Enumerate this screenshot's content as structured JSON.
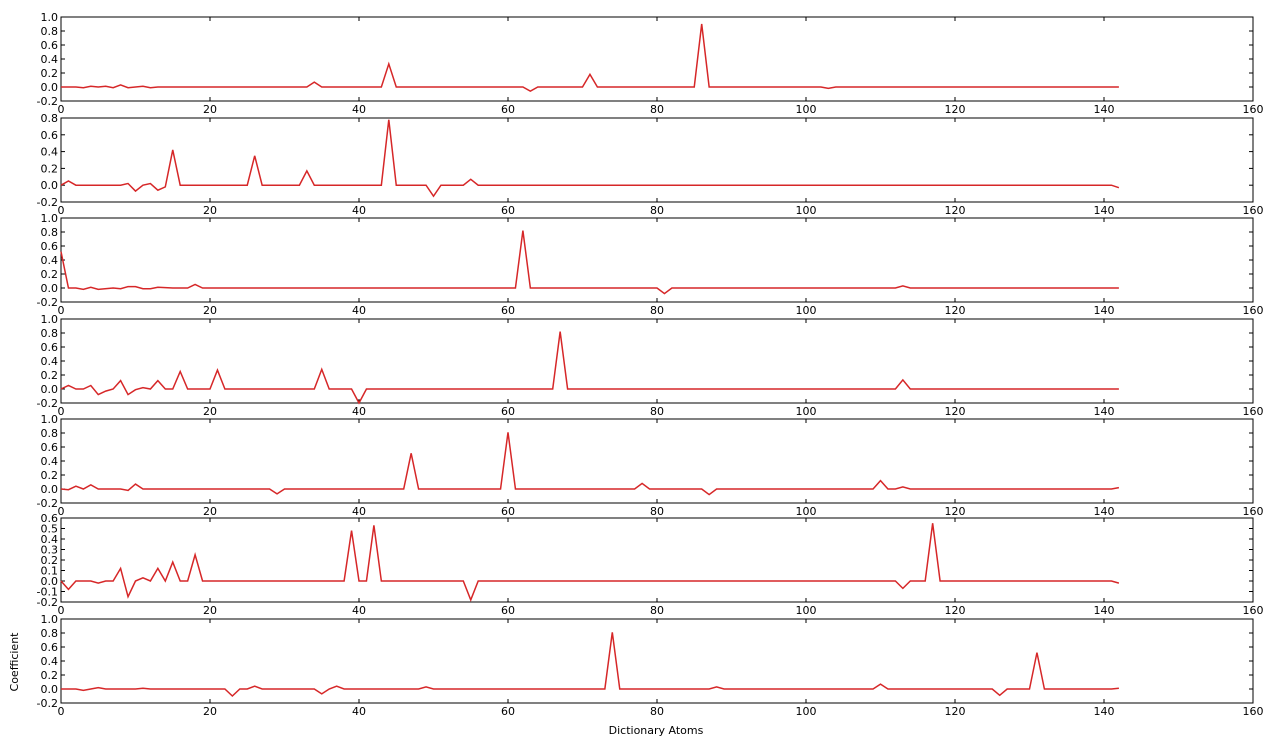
{
  "chart_data": {
    "type": "line",
    "xlabel": "Dictionary Atoms",
    "ylabel": "Coefficient",
    "line_color": "#d62728",
    "grid": false,
    "subplots": [
      {
        "xlim": [
          0,
          160
        ],
        "ylim": [
          -0.2,
          1.0
        ],
        "xticks": [
          0,
          20,
          40,
          60,
          80,
          100,
          120,
          140,
          160
        ],
        "yticks": [
          "1.0",
          "0.8",
          "0.6",
          "0.4",
          "0.2",
          "0.0",
          "-0.2"
        ],
        "ytick_values": [
          1.0,
          0.8,
          0.6,
          0.4,
          0.2,
          0.0,
          -0.2
        ],
        "points": [
          [
            0,
            0
          ],
          [
            2,
            0
          ],
          [
            3,
            -0.01
          ],
          [
            4,
            0.01
          ],
          [
            5,
            0
          ],
          [
            6,
            0.01
          ],
          [
            7,
            -0.01
          ],
          [
            8,
            0.03
          ],
          [
            9,
            -0.01
          ],
          [
            11,
            0.01
          ],
          [
            12,
            -0.01
          ],
          [
            13,
            0
          ],
          [
            33,
            0
          ],
          [
            34,
            0.07
          ],
          [
            35,
            0
          ],
          [
            43,
            0
          ],
          [
            44,
            0.33
          ],
          [
            45,
            0
          ],
          [
            62,
            0
          ],
          [
            63,
            -0.06
          ],
          [
            64,
            0
          ],
          [
            70,
            0
          ],
          [
            71,
            0.18
          ],
          [
            72,
            0
          ],
          [
            85,
            0
          ],
          [
            86,
            0.9
          ],
          [
            87,
            0
          ],
          [
            102,
            0
          ],
          [
            103,
            -0.02
          ],
          [
            104,
            0
          ],
          [
            142,
            0
          ]
        ]
      },
      {
        "xlim": [
          0,
          160
        ],
        "ylim": [
          -0.2,
          0.8
        ],
        "xticks": [
          0,
          20,
          40,
          60,
          80,
          100,
          120,
          140,
          160
        ],
        "yticks": [
          "0.8",
          "0.6",
          "0.4",
          "0.2",
          "0.0",
          "-0.2"
        ],
        "ytick_values": [
          0.8,
          0.6,
          0.4,
          0.2,
          0.0,
          -0.2
        ],
        "points": [
          [
            0,
            0
          ],
          [
            1,
            0.05
          ],
          [
            2,
            0
          ],
          [
            8,
            0
          ],
          [
            9,
            0.02
          ],
          [
            10,
            -0.07
          ],
          [
            11,
            0
          ],
          [
            12,
            0.02
          ],
          [
            13,
            -0.06
          ],
          [
            14,
            -0.02
          ],
          [
            15,
            0.42
          ],
          [
            16,
            0
          ],
          [
            25,
            0
          ],
          [
            26,
            0.35
          ],
          [
            27,
            0
          ],
          [
            32,
            0
          ],
          [
            33,
            0.17
          ],
          [
            34,
            0
          ],
          [
            43,
            0
          ],
          [
            44,
            0.78
          ],
          [
            45,
            0
          ],
          [
            49,
            0
          ],
          [
            50,
            -0.13
          ],
          [
            51,
            0
          ],
          [
            54,
            0
          ],
          [
            55,
            0.07
          ],
          [
            56,
            0
          ],
          [
            141,
            0
          ],
          [
            142,
            -0.03
          ]
        ]
      },
      {
        "xlim": [
          0,
          160
        ],
        "ylim": [
          -0.2,
          1.0
        ],
        "xticks": [
          0,
          20,
          40,
          60,
          80,
          100,
          120,
          140,
          160
        ],
        "yticks": [
          "1.0",
          "0.8",
          "0.6",
          "0.4",
          "0.2",
          "0.0",
          "-0.2"
        ],
        "ytick_values": [
          1.0,
          0.8,
          0.6,
          0.4,
          0.2,
          0.0,
          -0.2
        ],
        "points": [
          [
            0,
            0.52
          ],
          [
            1,
            0
          ],
          [
            2,
            0
          ],
          [
            3,
            -0.02
          ],
          [
            4,
            0.01
          ],
          [
            5,
            -0.02
          ],
          [
            7,
            0
          ],
          [
            8,
            -0.01
          ],
          [
            9,
            0.02
          ],
          [
            10,
            0.02
          ],
          [
            11,
            -0.01
          ],
          [
            12,
            -0.01
          ],
          [
            13,
            0.01
          ],
          [
            15,
            0
          ],
          [
            17,
            0
          ],
          [
            18,
            0.05
          ],
          [
            19,
            0
          ],
          [
            61,
            0
          ],
          [
            62,
            0.82
          ],
          [
            63,
            0
          ],
          [
            80,
            0
          ],
          [
            81,
            -0.08
          ],
          [
            82,
            0
          ],
          [
            112,
            0
          ],
          [
            113,
            0.03
          ],
          [
            114,
            0
          ],
          [
            142,
            0
          ]
        ]
      },
      {
        "xlim": [
          0,
          160
        ],
        "ylim": [
          -0.2,
          1.0
        ],
        "xticks": [
          0,
          20,
          40,
          60,
          80,
          100,
          120,
          140,
          160
        ],
        "yticks": [
          "1.0",
          "0.8",
          "0.6",
          "0.4",
          "0.2",
          "0.0",
          "-0.2"
        ],
        "ytick_values": [
          1.0,
          0.8,
          0.6,
          0.4,
          0.2,
          0.0,
          -0.2
        ],
        "points": [
          [
            0,
            0
          ],
          [
            1,
            0.05
          ],
          [
            2,
            0
          ],
          [
            3,
            0
          ],
          [
            4,
            0.05
          ],
          [
            5,
            -0.08
          ],
          [
            6,
            -0.03
          ],
          [
            7,
            0
          ],
          [
            8,
            0.12
          ],
          [
            9,
            -0.08
          ],
          [
            10,
            -0.01
          ],
          [
            11,
            0.02
          ],
          [
            12,
            0
          ],
          [
            13,
            0.12
          ],
          [
            14,
            0
          ],
          [
            15,
            0
          ],
          [
            16,
            0.25
          ],
          [
            17,
            0
          ],
          [
            20,
            0
          ],
          [
            21,
            0.27
          ],
          [
            22,
            0
          ],
          [
            34,
            0
          ],
          [
            35,
            0.28
          ],
          [
            36,
            0
          ],
          [
            39,
            0
          ],
          [
            40,
            -0.2
          ],
          [
            41,
            0
          ],
          [
            66,
            0
          ],
          [
            67,
            0.82
          ],
          [
            68,
            0
          ],
          [
            112,
            0
          ],
          [
            113,
            0.13
          ],
          [
            114,
            0
          ],
          [
            142,
            0
          ]
        ]
      },
      {
        "xlim": [
          0,
          160
        ],
        "ylim": [
          -0.2,
          1.0
        ],
        "xticks": [
          0,
          20,
          40,
          60,
          80,
          100,
          120,
          140,
          160
        ],
        "yticks": [
          "1.0",
          "0.8",
          "0.6",
          "0.4",
          "0.2",
          "0.0",
          "-0.2"
        ],
        "ytick_values": [
          1.0,
          0.8,
          0.6,
          0.4,
          0.2,
          0.0,
          -0.2
        ],
        "points": [
          [
            0,
            0
          ],
          [
            1,
            -0.01
          ],
          [
            2,
            0.04
          ],
          [
            3,
            0
          ],
          [
            4,
            0.06
          ],
          [
            5,
            0
          ],
          [
            8,
            0
          ],
          [
            9,
            -0.02
          ],
          [
            10,
            0.07
          ],
          [
            11,
            0
          ],
          [
            28,
            0
          ],
          [
            29,
            -0.07
          ],
          [
            30,
            0
          ],
          [
            46,
            0
          ],
          [
            47,
            0.51
          ],
          [
            48,
            0
          ],
          [
            59,
            0
          ],
          [
            60,
            0.81
          ],
          [
            61,
            0
          ],
          [
            77,
            0
          ],
          [
            78,
            0.08
          ],
          [
            79,
            0
          ],
          [
            86,
            0
          ],
          [
            87,
            -0.08
          ],
          [
            88,
            0
          ],
          [
            109,
            0
          ],
          [
            110,
            0.12
          ],
          [
            111,
            0
          ],
          [
            112,
            0
          ],
          [
            113,
            0.03
          ],
          [
            114,
            0
          ],
          [
            141,
            0
          ],
          [
            142,
            0.02
          ]
        ]
      },
      {
        "xlim": [
          0,
          160
        ],
        "ylim": [
          -0.2,
          0.6
        ],
        "xticks": [
          0,
          20,
          40,
          60,
          80,
          100,
          120,
          140,
          160
        ],
        "yticks": [
          "0.6",
          "0.5",
          "0.4",
          "0.3",
          "0.2",
          "0.1",
          "0.0",
          "-0.1",
          "-0.2"
        ],
        "ytick_values": [
          0.6,
          0.5,
          0.4,
          0.3,
          0.2,
          0.1,
          0.0,
          -0.1,
          -0.2
        ],
        "points": [
          [
            0,
            0
          ],
          [
            1,
            -0.08
          ],
          [
            2,
            0
          ],
          [
            4,
            0
          ],
          [
            5,
            -0.02
          ],
          [
            6,
            0
          ],
          [
            7,
            0
          ],
          [
            8,
            0.12
          ],
          [
            9,
            -0.15
          ],
          [
            10,
            0
          ],
          [
            11,
            0.03
          ],
          [
            12,
            0
          ],
          [
            13,
            0.12
          ],
          [
            14,
            0
          ],
          [
            15,
            0.18
          ],
          [
            16,
            0
          ],
          [
            17,
            0
          ],
          [
            18,
            0.25
          ],
          [
            19,
            0
          ],
          [
            38,
            0
          ],
          [
            39,
            0.48
          ],
          [
            40,
            0
          ],
          [
            41,
            0
          ],
          [
            42,
            0.53
          ],
          [
            43,
            0
          ],
          [
            54,
            0
          ],
          [
            55,
            -0.18
          ],
          [
            56,
            0
          ],
          [
            112,
            0
          ],
          [
            113,
            -0.07
          ],
          [
            114,
            0
          ],
          [
            116,
            0
          ],
          [
            117,
            0.55
          ],
          [
            118,
            0
          ],
          [
            141,
            0
          ],
          [
            142,
            -0.02
          ]
        ]
      },
      {
        "xlim": [
          0,
          160
        ],
        "ylim": [
          -0.2,
          1.0
        ],
        "xticks": [
          0,
          20,
          40,
          60,
          80,
          100,
          120,
          140,
          160
        ],
        "yticks": [
          "1.0",
          "0.8",
          "0.6",
          "0.4",
          "0.2",
          "0.0",
          "-0.2"
        ],
        "ytick_values": [
          1.0,
          0.8,
          0.6,
          0.4,
          0.2,
          0.0,
          -0.2
        ],
        "points": [
          [
            0,
            0
          ],
          [
            2,
            0
          ],
          [
            3,
            -0.02
          ],
          [
            4,
            0
          ],
          [
            5,
            0.02
          ],
          [
            6,
            0
          ],
          [
            10,
            0
          ],
          [
            11,
            0.01
          ],
          [
            12,
            0
          ],
          [
            22,
            0
          ],
          [
            23,
            -0.1
          ],
          [
            24,
            0
          ],
          [
            25,
            0
          ],
          [
            26,
            0.04
          ],
          [
            27,
            0
          ],
          [
            34,
            0
          ],
          [
            35,
            -0.07
          ],
          [
            36,
            0
          ],
          [
            37,
            0.04
          ],
          [
            38,
            0
          ],
          [
            48,
            0
          ],
          [
            49,
            0.03
          ],
          [
            50,
            0
          ],
          [
            73,
            0
          ],
          [
            74,
            0.81
          ],
          [
            75,
            0
          ],
          [
            87,
            0
          ],
          [
            88,
            0.03
          ],
          [
            89,
            0
          ],
          [
            109,
            0
          ],
          [
            110,
            0.07
          ],
          [
            111,
            0
          ],
          [
            125,
            0
          ],
          [
            126,
            -0.09
          ],
          [
            127,
            0
          ],
          [
            130,
            0
          ],
          [
            131,
            0.52
          ],
          [
            132,
            0
          ],
          [
            141,
            0
          ],
          [
            142,
            0.01
          ]
        ]
      }
    ]
  }
}
